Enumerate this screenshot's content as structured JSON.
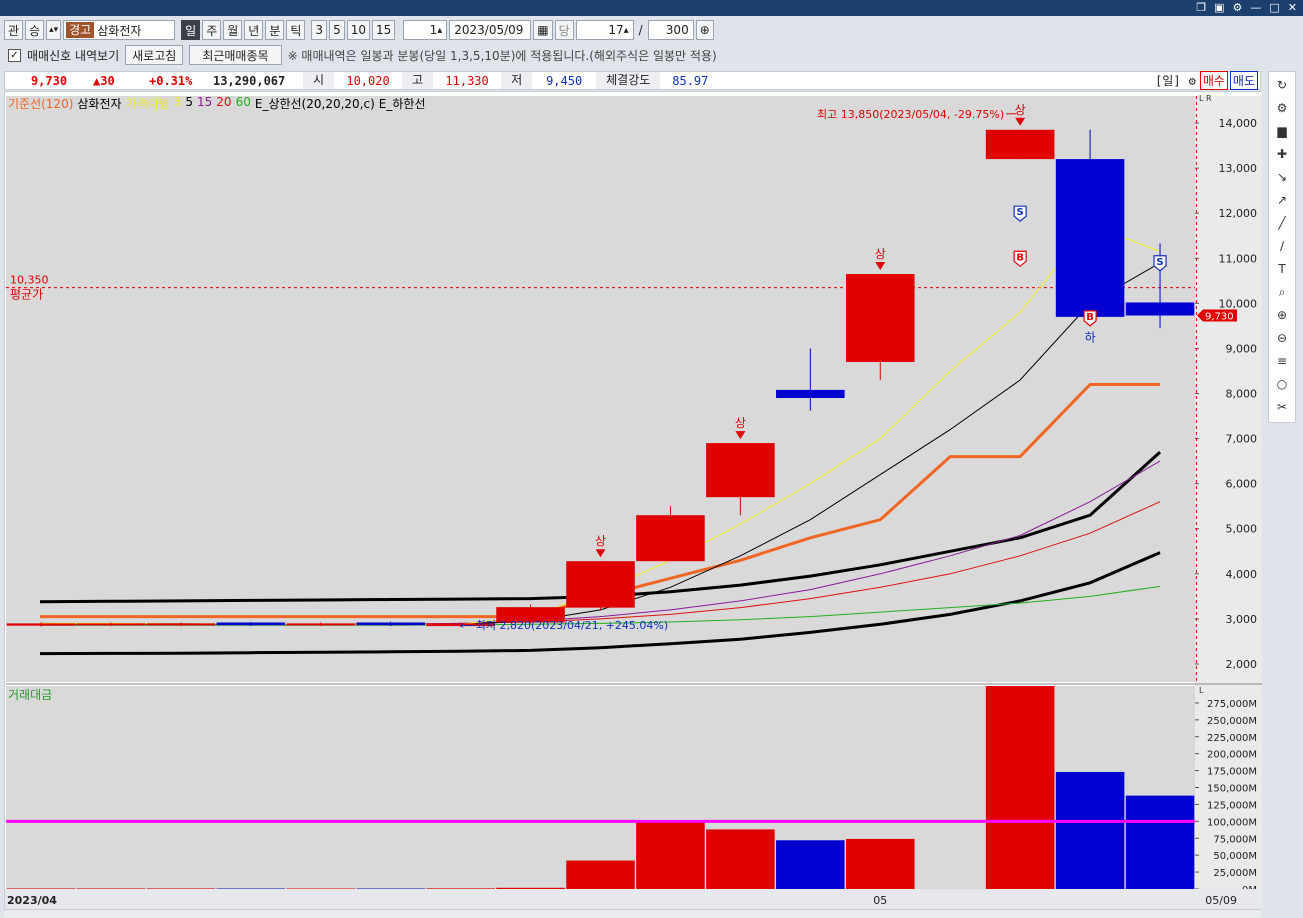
{
  "toolbar": {
    "btn_gwan": "관",
    "btn_seung": "승",
    "warn_tag": "경고",
    "stock_name": "삼화전자",
    "periods": [
      "일",
      "주",
      "월",
      "년",
      "분",
      "틱"
    ],
    "period_selected": "일",
    "intervals": [
      "3",
      "5",
      "10",
      "15"
    ],
    "interval_value": "1",
    "date": "2023/05/09",
    "dang_label": "당",
    "count_value": "17",
    "slash": "/",
    "total_value": "300"
  },
  "toolbar2": {
    "signal_check_label": "매매신호 내역보기",
    "refresh_label": "새로고침",
    "recent_label": "최근매매종목",
    "notice": "※ 매매내역은 일봉과 분봉(당일 1,3,5,10분)에 적용됩니다.(해외주식은 일봉만 적용)"
  },
  "pricebar": {
    "price": "9,730",
    "change": "▲30",
    "change_pct": "+0.31%",
    "volume": "13,290,067",
    "open_label": "시",
    "open": "10,020",
    "high_label": "고",
    "high": "11,330",
    "low_label": "저",
    "low": "9,450",
    "strength_label": "체결강도",
    "strength": "85.97",
    "period_tag": "[일]",
    "buy_label": "매수",
    "sell_label": "매도"
  },
  "legend": {
    "base_line": "기준선(120)",
    "name": "삼화전자",
    "ma_label": "가격이평",
    "ma_periods": [
      "3",
      "5",
      "15",
      "20",
      "60"
    ],
    "upper": "E_상한선(20,20,20,c)",
    "lower": "E_하한선"
  },
  "volume_legend": "거래대금",
  "annotations": {
    "high_note": "최고 13,850(2023/05/04, -29.75%)",
    "low_note": "최저 2,820(2023/04/21, +245.04%)",
    "avg_price_value": "10,350",
    "avg_price_label": "평균가",
    "sang": "상",
    "ha": "하",
    "current_tag": "9,730",
    "signal_s": "S",
    "signal_b": "B"
  },
  "colors": {
    "up": "#e00000",
    "down": "#0000d0",
    "base_line": "#f26522",
    "ma3": "#f0f020",
    "ma5": "#000000",
    "ma15": "#8b1a9a",
    "ma20": "#e01010",
    "ma60": "#20b020",
    "envelope": "#000000",
    "volume_avg": "#ff00ff"
  },
  "chart_data": {
    "type": "candlestick",
    "price_axis": {
      "ylim": [
        1600,
        14600
      ],
      "ticks": [
        "2,000",
        "3,000",
        "4,000",
        "5,000",
        "6,000",
        "7,000",
        "8,000",
        "9,000",
        "10,000",
        "11,000",
        "12,000",
        "13,000",
        "14,000"
      ]
    },
    "volume_axis": {
      "ylim": [
        0,
        300000
      ],
      "ticks": [
        "0M",
        "25,000M",
        "50,000M",
        "75,000M",
        "100,000M",
        "125,000M",
        "150,000M",
        "175,000M",
        "200,000M",
        "225,000M",
        "250,000M",
        "275,000M"
      ],
      "avg_line": 100000
    },
    "x_labels": [
      "2023/04",
      "05",
      "05/09"
    ],
    "candles": [
      {
        "open": 2850,
        "close": 2900,
        "high": 2920,
        "low": 2830,
        "volume": 800
      },
      {
        "open": 2860,
        "close": 2900,
        "high": 2920,
        "low": 2840,
        "volume": 800
      },
      {
        "open": 2860,
        "close": 2900,
        "high": 2920,
        "low": 2840,
        "volume": 800
      },
      {
        "open": 2920,
        "close": 2860,
        "high": 2930,
        "low": 2840,
        "volume": 700
      },
      {
        "open": 2860,
        "close": 2900,
        "high": 2920,
        "low": 2840,
        "volume": 700
      },
      {
        "open": 2920,
        "close": 2860,
        "high": 2940,
        "low": 2840,
        "volume": 700
      },
      {
        "open": 2840,
        "close": 2900,
        "high": 2920,
        "low": 2820,
        "volume": 900
      },
      {
        "open": 2920,
        "close": 3260,
        "high": 3320,
        "low": 2900,
        "volume": 1800
      },
      {
        "open": 3250,
        "close": 4280,
        "high": 4280,
        "low": 3200,
        "volume": 42000
      },
      {
        "open": 4280,
        "close": 5300,
        "high": 5500,
        "low": 4280,
        "volume": 100000
      },
      {
        "open": 5700,
        "close": 6900,
        "high": 6900,
        "low": 5300,
        "volume": 88000
      },
      {
        "open": 8080,
        "close": 7900,
        "high": 9000,
        "low": 7620,
        "volume": 72000
      },
      {
        "open": 8700,
        "close": 10650,
        "high": 10650,
        "low": 8300,
        "volume": 74000
      },
      null,
      {
        "open": 13200,
        "close": 13850,
        "high": 13850,
        "low": 13200,
        "volume": 300000
      },
      {
        "open": 13200,
        "close": 9700,
        "high": 13850,
        "low": 9700,
        "volume": 173000
      },
      {
        "open": 10020,
        "close": 9730,
        "high": 11330,
        "low": 9450,
        "volume": 138000
      }
    ],
    "series": [
      {
        "name": "기준선(120)",
        "values": [
          3050,
          3050,
          3050,
          3050,
          3050,
          3050,
          3050,
          3050,
          3500,
          3900,
          4300,
          4800,
          5200,
          6600,
          6600,
          8200,
          8200
        ]
      },
      {
        "name": "3",
        "values": [
          2900,
          2900,
          2890,
          2890,
          2880,
          2880,
          2880,
          3060,
          3600,
          4300,
          5100,
          6000,
          7000,
          8500,
          9800,
          11750,
          11150
        ]
      },
      {
        "name": "5",
        "values": [
          2900,
          2890,
          2890,
          2880,
          2880,
          2880,
          2880,
          2950,
          3200,
          3700,
          4400,
          5200,
          6200,
          7200,
          8300,
          10000,
          10900
        ]
      },
      {
        "name": "15",
        "values": [
          2890,
          2890,
          2890,
          2880,
          2880,
          2880,
          2900,
          2950,
          3050,
          3200,
          3400,
          3650,
          4000,
          4400,
          4850,
          5600,
          6500
        ]
      },
      {
        "name": "20",
        "values": [
          2880,
          2880,
          2880,
          2880,
          2880,
          2880,
          2900,
          2930,
          3000,
          3100,
          3250,
          3450,
          3700,
          4000,
          4400,
          4900,
          5600
        ]
      },
      {
        "name": "60",
        "values": [
          2860,
          2860,
          2860,
          2860,
          2860,
          2860,
          2870,
          2880,
          2900,
          2930,
          2980,
          3050,
          3150,
          3250,
          3350,
          3500,
          3720
        ]
      },
      {
        "name": "E_상한선(20,20,20,c)",
        "values": [
          3380,
          3390,
          3400,
          3410,
          3420,
          3430,
          3440,
          3450,
          3500,
          3600,
          3750,
          3950,
          4200,
          4500,
          4800,
          5300,
          6700
        ]
      },
      {
        "name": "E_하한선",
        "values": [
          2230,
          2235,
          2240,
          2250,
          2260,
          2270,
          2280,
          2300,
          2360,
          2450,
          2550,
          2700,
          2880,
          3100,
          3400,
          3800,
          4470
        ]
      }
    ]
  }
}
